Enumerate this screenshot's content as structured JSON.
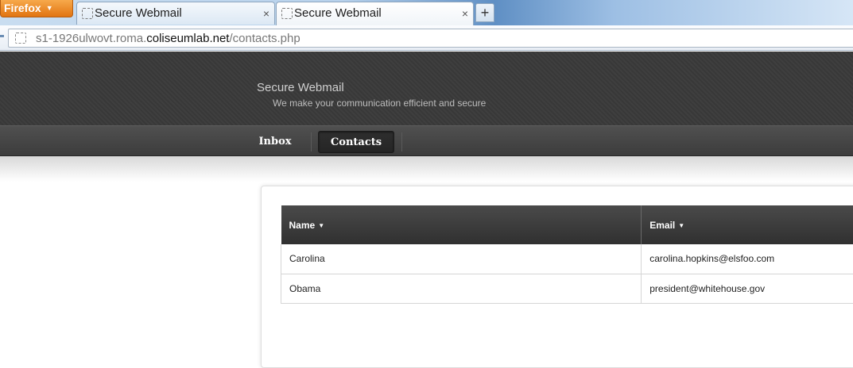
{
  "browser": {
    "menu_button_label": "Firefox",
    "tabs": [
      {
        "title": "Secure Webmail",
        "active": false
      },
      {
        "title": "Secure Webmail",
        "active": true
      }
    ],
    "new_tab_label": "+",
    "close_label": "×",
    "url": {
      "prefix": "s1-1926ulwovt.roma.",
      "domain": "coliseumlab.net",
      "path": "/contacts.php"
    }
  },
  "site": {
    "title": "Secure Webmail",
    "tagline": "We make your communication efficient and secure",
    "nav": [
      {
        "label": "Inbox",
        "active": false
      },
      {
        "label": "Contacts",
        "active": true
      }
    ]
  },
  "contacts": {
    "columns": [
      {
        "label": "Name",
        "sortable": true
      },
      {
        "label": "Email",
        "sortable": true
      }
    ],
    "rows": [
      {
        "name": "Carolina",
        "email": "carolina.hopkins@elsfoo.com"
      },
      {
        "name": "Obama",
        "email": "president@whitehouse.gov"
      }
    ]
  },
  "icons": {
    "menu_arrow": "dropdown-arrow-icon",
    "favicon": "page-icon",
    "sort": "sort-caret-icon"
  },
  "colors": {
    "header_bg": "#3a3a3a",
    "nav_bg": "#444444",
    "table_header_bg": "#3c3c3c",
    "firefox_orange": "#e98b2a"
  }
}
